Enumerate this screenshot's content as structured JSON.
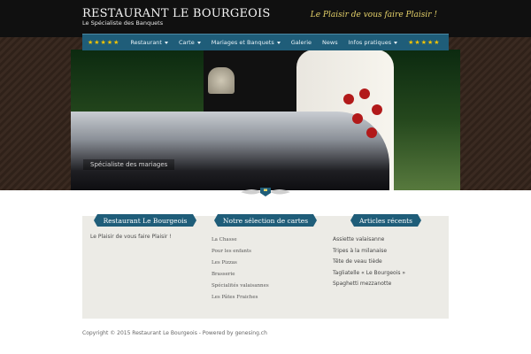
{
  "header": {
    "title": "RESTAURANT LE BOURGEOIS",
    "subtitle": "Le Spécialiste des Banquets",
    "tagline": "Le Plaisir de vous faire Plaisir !"
  },
  "nav": {
    "stars": "★★★★★",
    "items": [
      {
        "label": "Restaurant",
        "dropdown": true
      },
      {
        "label": "Carte",
        "dropdown": true
      },
      {
        "label": "Mariages et Banquets",
        "dropdown": true
      },
      {
        "label": "Galerie",
        "dropdown": false
      },
      {
        "label": "News",
        "dropdown": false
      },
      {
        "label": "Infos pratiques",
        "dropdown": true
      }
    ]
  },
  "hero": {
    "caption": "Spécialiste des mariages"
  },
  "columns": {
    "left": {
      "title": "Restaurant Le Bourgeois",
      "text": "Le Plaisir de vous faire Plaisir !"
    },
    "middle": {
      "title": "Notre sélection de cartes",
      "items": [
        "La Chasse",
        "Pour les enfants",
        "Les Pizzas",
        "Brasserie",
        "Spécialités valaisannes",
        "Les Pâtes Fraiches"
      ]
    },
    "right": {
      "title": "Articles récents",
      "items": [
        "Assiette valaisanne",
        "Tripes à la milanaise",
        "Tête de veau tiède",
        "Tagliatelle « Le Bourgeois »",
        "Spaghetti mezzanotte"
      ]
    }
  },
  "footer": {
    "text": "Copyright © 2015 Restaurant Le Bourgeois - Powered by genesing.ch"
  },
  "colors": {
    "nav": "#1f5d79",
    "tagline": "#e7d36a",
    "header": "#101010"
  }
}
